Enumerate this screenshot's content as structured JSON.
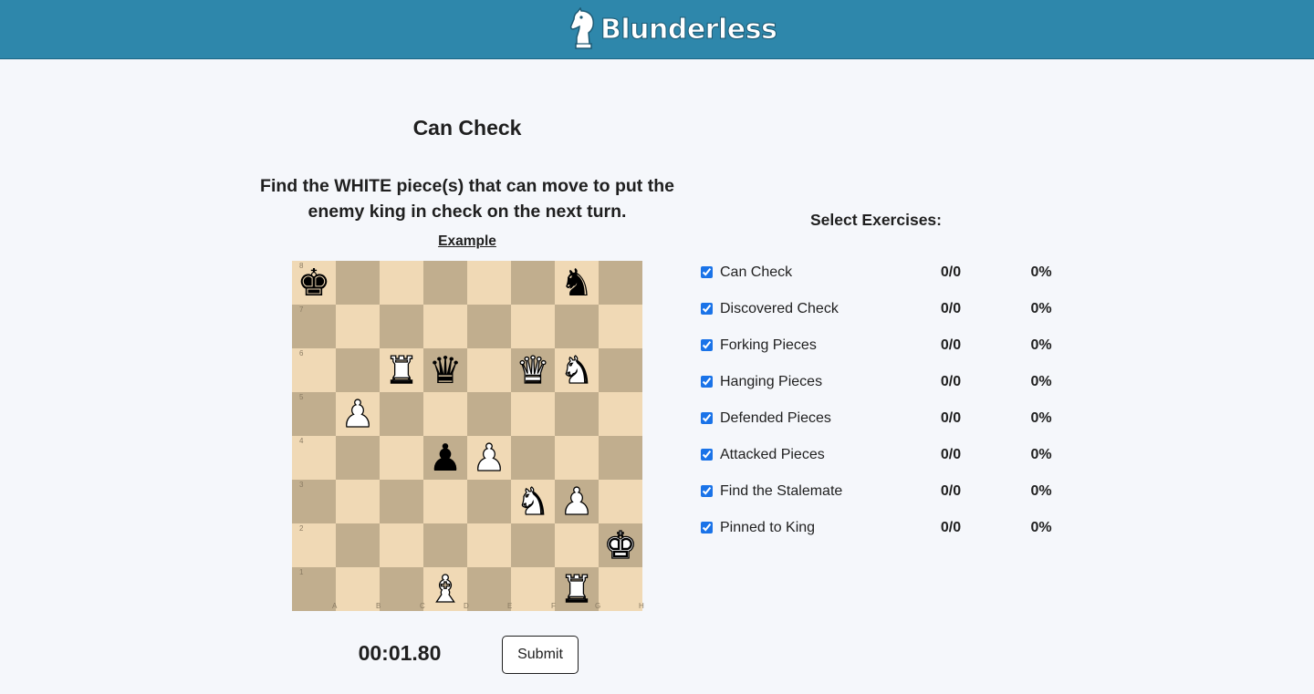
{
  "header": {
    "brand": "Blunderless",
    "logo_icon": "knight-logo-icon",
    "background": "#2e87ab"
  },
  "exercise": {
    "title": "Can Check",
    "description": "Find the WHITE piece(s) that can move to put the enemy king in check on the next turn.",
    "example_link": "Example"
  },
  "board": {
    "light_color": "#f0d9b5",
    "dark_color": "#c1ae8e",
    "rank_labels": [
      "8",
      "7",
      "6",
      "5",
      "4",
      "3",
      "2",
      "1"
    ],
    "file_labels": [
      "A",
      "B",
      "C",
      "D",
      "E",
      "F",
      "G",
      "H"
    ],
    "pieces": [
      {
        "square": "a8",
        "color": "black",
        "type": "king"
      },
      {
        "square": "g8",
        "color": "black",
        "type": "knight"
      },
      {
        "square": "c6",
        "color": "white",
        "type": "rook"
      },
      {
        "square": "d6",
        "color": "black",
        "type": "queen"
      },
      {
        "square": "f6",
        "color": "white",
        "type": "queen"
      },
      {
        "square": "g6",
        "color": "white",
        "type": "knight"
      },
      {
        "square": "b5",
        "color": "white",
        "type": "pawn"
      },
      {
        "square": "d4",
        "color": "black",
        "type": "pawn"
      },
      {
        "square": "e4",
        "color": "white",
        "type": "pawn"
      },
      {
        "square": "f3",
        "color": "white",
        "type": "knight"
      },
      {
        "square": "g3",
        "color": "white",
        "type": "pawn"
      },
      {
        "square": "h2",
        "color": "white",
        "type": "king"
      },
      {
        "square": "d1",
        "color": "white",
        "type": "bishop"
      },
      {
        "square": "g1",
        "color": "white",
        "type": "rook"
      }
    ]
  },
  "controls": {
    "timer": "00:01.80",
    "submit_label": "Submit"
  },
  "exercises_panel": {
    "title": "Select Exercises:",
    "items": [
      {
        "name": "Can Check",
        "score": "0/0",
        "percent": "0%",
        "checked": true
      },
      {
        "name": "Discovered Check",
        "score": "0/0",
        "percent": "0%",
        "checked": true
      },
      {
        "name": "Forking Pieces",
        "score": "0/0",
        "percent": "0%",
        "checked": true
      },
      {
        "name": "Hanging Pieces",
        "score": "0/0",
        "percent": "0%",
        "checked": true
      },
      {
        "name": "Defended Pieces",
        "score": "0/0",
        "percent": "0%",
        "checked": true
      },
      {
        "name": "Attacked Pieces",
        "score": "0/0",
        "percent": "0%",
        "checked": true
      },
      {
        "name": "Find the Stalemate",
        "score": "0/0",
        "percent": "0%",
        "checked": true
      },
      {
        "name": "Pinned to King",
        "score": "0/0",
        "percent": "0%",
        "checked": true
      }
    ]
  }
}
